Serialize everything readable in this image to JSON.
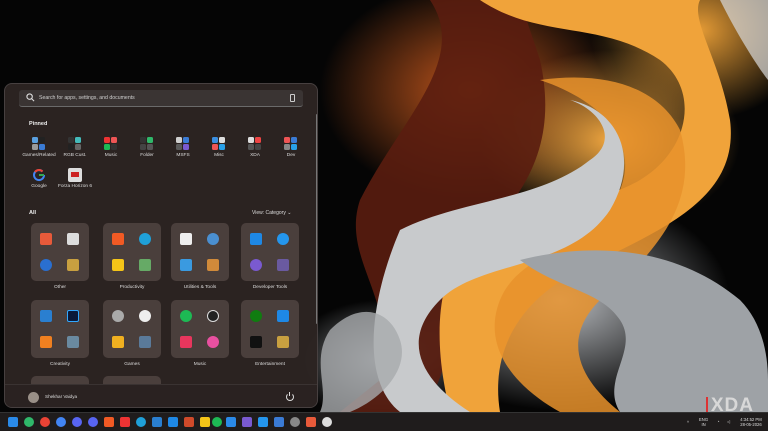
{
  "watermark": "XDA",
  "search": {
    "placeholder": "Search for apps, settings, and documents"
  },
  "pinned": {
    "title": "Pinned",
    "items": [
      {
        "label": "Games/Related"
      },
      {
        "label": "RGB Cust."
      },
      {
        "label": "Music"
      },
      {
        "label": "Folder"
      },
      {
        "label": "MSFS"
      },
      {
        "label": "Misc"
      },
      {
        "label": "XDA"
      },
      {
        "label": "Dev"
      },
      {
        "label": "Google"
      },
      {
        "label": "Forza Horizon 6"
      }
    ]
  },
  "all": {
    "title": "All",
    "view_label": "View: Category",
    "groups": [
      {
        "label": "Other"
      },
      {
        "label": "Productivity"
      },
      {
        "label": "Utilities & Tools"
      },
      {
        "label": "Developer Tools"
      },
      {
        "label": "Creativity"
      },
      {
        "label": "Games"
      },
      {
        "label": "Music"
      },
      {
        "label": "Entertainment"
      }
    ]
  },
  "user": {
    "name": "Shekhar Vaidya"
  },
  "tray": {
    "lang_line1": "ENG",
    "lang_line2": "IN",
    "time": "4:34:52 PM",
    "date": "28-05-2026"
  },
  "colors": {
    "accent": "#0078d4",
    "menu_bg": "#2c2422"
  }
}
